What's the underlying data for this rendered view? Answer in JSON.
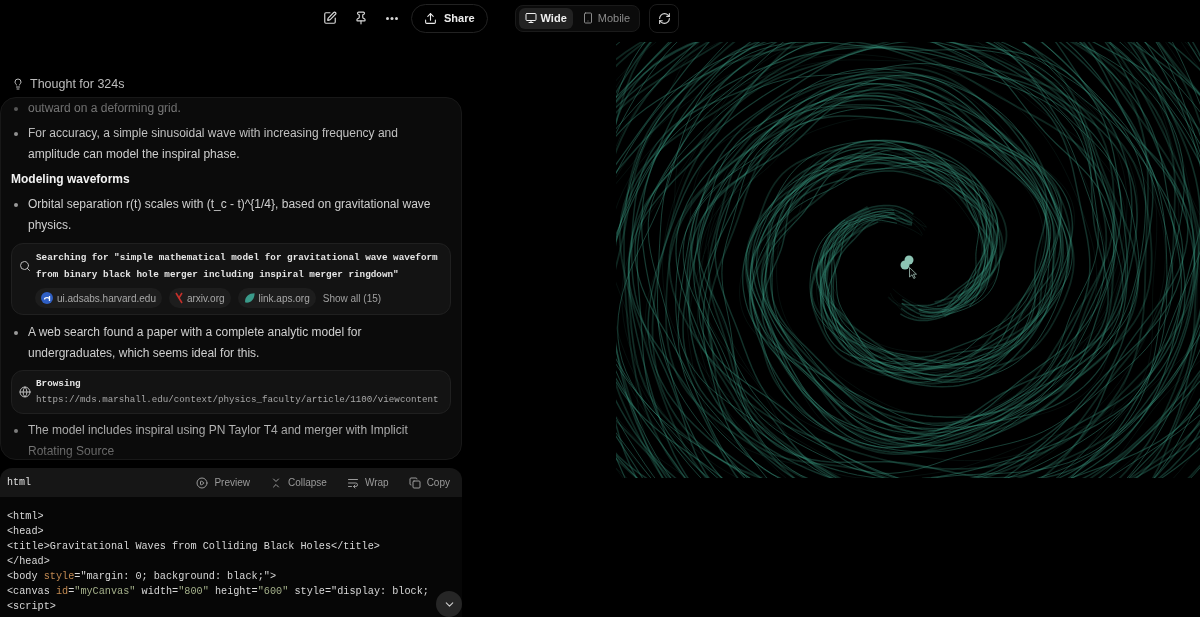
{
  "toolbar": {
    "share": "Share",
    "view_modes": [
      {
        "kind": "desktop",
        "label": "Wide",
        "selected": true
      },
      {
        "kind": "mobile",
        "label": "Mobile",
        "selected": false
      }
    ]
  },
  "thinking": {
    "label": "Thought for 324s",
    "items": [
      {
        "kind": "bullet",
        "text": "outward on a deforming grid."
      },
      {
        "kind": "bullet",
        "text": "For accuracy, a simple sinusoidal wave with increasing frequency and amplitude can model the inspiral phase."
      },
      {
        "kind": "heading",
        "text": "Modeling waveforms"
      },
      {
        "kind": "bullet",
        "text": "Orbital separation r(t) scales with (t_c - t)^{1/4}, based on gravitational wave physics."
      },
      {
        "kind": "search",
        "text": "Searching for \"simple mathematical model for gravitational wave waveform from binary black hole merger including inspiral merger ringdown\"",
        "sources": [
          {
            "kind": "ads",
            "label": "ui.adsabs.harvard.edu"
          },
          {
            "kind": "arxiv",
            "label": "arxiv.org"
          },
          {
            "kind": "aps",
            "label": "link.aps.org"
          }
        ],
        "show_all": "Show all (15)"
      },
      {
        "kind": "bullet",
        "text": "A web search found a paper with a complete analytic model for undergraduates, which seems ideal for this."
      },
      {
        "kind": "browse",
        "title": "Browsing",
        "url": "https://mds.marshall.edu/context/physics_faculty/article/1100/viewcontent"
      },
      {
        "kind": "bullet",
        "text": "The model includes inspiral using PN Taylor T4 and merger with Implicit Rotating Source"
      }
    ]
  },
  "code": {
    "language": "html",
    "actions": [
      {
        "kind": "preview",
        "label": "Preview"
      },
      {
        "kind": "collapse",
        "label": "Collapse"
      },
      {
        "kind": "wrap",
        "label": "Wrap"
      },
      {
        "kind": "copy",
        "label": "Copy"
      }
    ],
    "lines": [
      [
        {
          "kind": "plain",
          "text": "<html>"
        }
      ],
      [
        {
          "kind": "plain",
          "text": "<head>"
        }
      ],
      [
        {
          "kind": "plain",
          "text": "<title>Gravitational Waves from Colliding Black Holes</title>"
        }
      ],
      [
        {
          "kind": "plain",
          "text": "</head>"
        }
      ],
      [
        {
          "kind": "plain",
          "text": "<body "
        },
        {
          "kind": "attr",
          "text": "style"
        },
        {
          "kind": "plain",
          "text": "=\"margin: 0; background: black;\">"
        }
      ],
      [
        {
          "kind": "plain",
          "text": "<canvas "
        },
        {
          "kind": "attr",
          "text": "id"
        },
        {
          "kind": "plain",
          "text": "="
        },
        {
          "kind": "string",
          "text": "\"myCanvas\""
        },
        {
          "kind": "plain",
          "text": " width="
        },
        {
          "kind": "string",
          "text": "\"800\""
        },
        {
          "kind": "plain",
          "text": " height="
        },
        {
          "kind": "string",
          "text": "\"600\""
        },
        {
          "kind": "plain",
          "text": " style=\"display: block;"
        }
      ],
      [
        {
          "kind": "plain",
          "text": "<script>"
        }
      ]
    ]
  }
}
